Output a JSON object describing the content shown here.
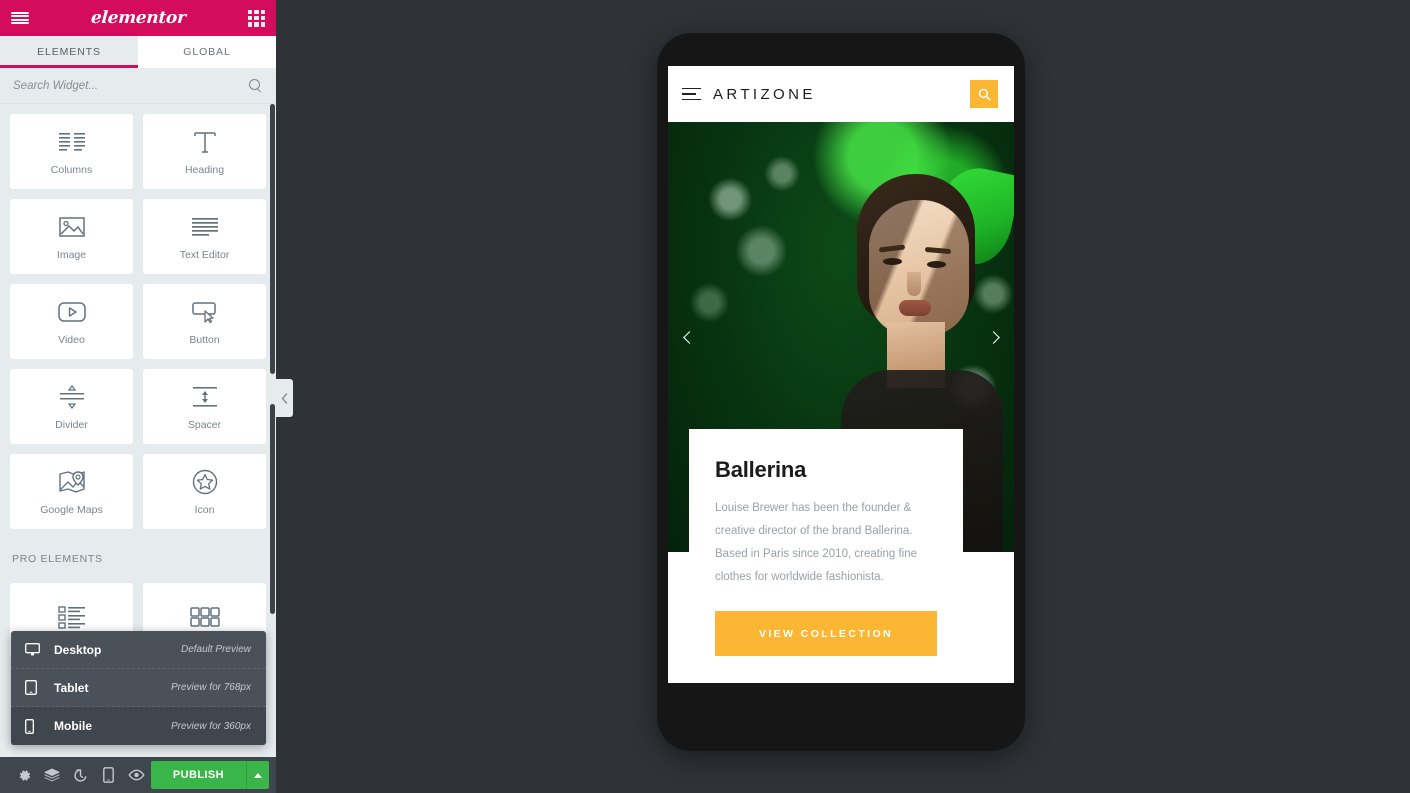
{
  "panel": {
    "header": {
      "menu_icon": "hamburger-icon",
      "logo": "elementor",
      "apps_icon": "grid-icon"
    },
    "tabs": [
      {
        "label": "ELEMENTS",
        "active": true
      },
      {
        "label": "GLOBAL",
        "active": false
      }
    ],
    "search": {
      "placeholder": "Search Widget...",
      "value": "",
      "icon": "search-icon"
    },
    "widgets": [
      {
        "label": "Columns",
        "icon": "columns-icon"
      },
      {
        "label": "Heading",
        "icon": "heading-icon"
      },
      {
        "label": "Image",
        "icon": "image-icon"
      },
      {
        "label": "Text Editor",
        "icon": "text-editor-icon"
      },
      {
        "label": "Video",
        "icon": "video-icon"
      },
      {
        "label": "Button",
        "icon": "button-icon"
      },
      {
        "label": "Divider",
        "icon": "divider-icon"
      },
      {
        "label": "Spacer",
        "icon": "spacer-icon"
      },
      {
        "label": "Google Maps",
        "icon": "google-maps-icon"
      },
      {
        "label": "Icon",
        "icon": "star-icon"
      }
    ],
    "pro_section_title": "PRO ELEMENTS",
    "pro_widgets": [
      {
        "label": "",
        "icon": "posts-icon"
      },
      {
        "label": "",
        "icon": "gallery-icon"
      }
    ],
    "device_popup": [
      {
        "label": "Desktop",
        "note": "Default Preview",
        "icon": "desktop-icon",
        "selected": false
      },
      {
        "label": "Tablet",
        "note": "Preview for 768px",
        "icon": "tablet-icon",
        "selected": false
      },
      {
        "label": "Mobile",
        "note": "Preview for 360px",
        "icon": "mobile-icon",
        "selected": true
      }
    ],
    "footer": {
      "icons": [
        {
          "name": "settings-gear-icon"
        },
        {
          "name": "navigator-layers-icon"
        },
        {
          "name": "history-icon"
        },
        {
          "name": "responsive-mode-icon"
        },
        {
          "name": "preview-eye-icon"
        }
      ],
      "publish_label": "PUBLISH",
      "publish_caret_icon": "caret-up-icon"
    },
    "collapse_handle_icon": "chevron-left-icon"
  },
  "preview": {
    "site_header": {
      "menu_icon": "hamburger-icon",
      "brand": "ARTIZONE",
      "search_icon": "search-icon"
    },
    "slider": {
      "prev_icon": "chevron-left-icon",
      "next_icon": "chevron-right-icon"
    },
    "card": {
      "title": "Ballerina",
      "body": "Louise Brewer has been the founder & creative director of the brand Ballerina. Based in Paris since 2010, creating fine clothes for worldwide fashionista.",
      "cta_label": "VIEW COLLECTION"
    }
  },
  "colors": {
    "brand_pink": "#d30c5c",
    "panel_bg": "#e6ebee",
    "canvas_bg": "#2f3337",
    "footer_bg": "#3f464d",
    "publish_green": "#39b54a",
    "accent_yellow": "#fbb633",
    "popup_bg": "#4a5159"
  }
}
